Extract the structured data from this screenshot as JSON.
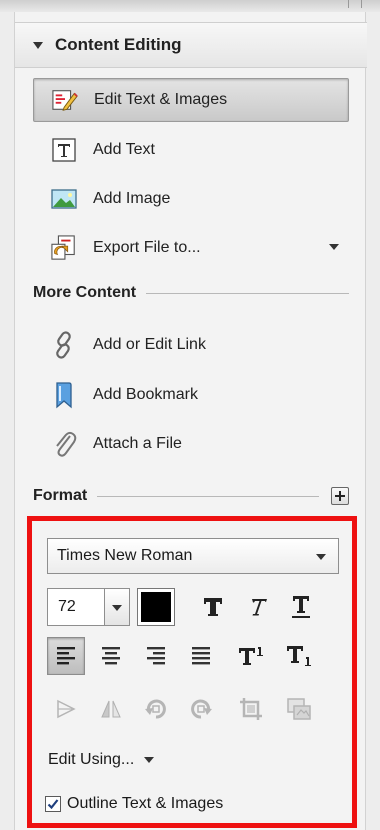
{
  "section": {
    "title": "Content Editing"
  },
  "tools": [
    {
      "label": "Edit Text & Images",
      "icon": "edit-text-images-icon"
    },
    {
      "label": "Add Text",
      "icon": "add-text-icon"
    },
    {
      "label": "Add Image",
      "icon": "add-image-icon"
    },
    {
      "label": "Export File to...",
      "icon": "export-file-icon"
    }
  ],
  "more_content": {
    "title": "More Content",
    "items": [
      {
        "label": "Add or Edit Link",
        "icon": "link-icon"
      },
      {
        "label": "Add Bookmark",
        "icon": "bookmark-icon"
      },
      {
        "label": "Attach a File",
        "icon": "paperclip-icon"
      }
    ]
  },
  "format": {
    "title": "Format",
    "font": "Times New Roman",
    "size": "72",
    "text_color": "#000000",
    "edit_using": "Edit Using...",
    "outline_label": "Outline Text & Images",
    "outline_checked": true
  },
  "colors": {
    "highlight_border": "#ee1111"
  }
}
